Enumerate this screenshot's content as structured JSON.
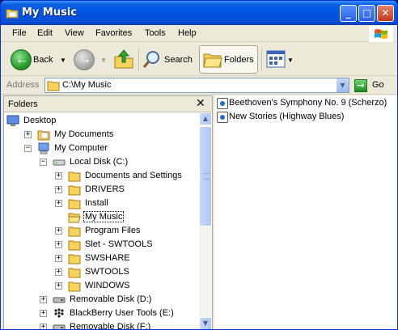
{
  "window": {
    "title": "My Music"
  },
  "menu": [
    "File",
    "Edit",
    "View",
    "Favorites",
    "Tools",
    "Help"
  ],
  "toolbar": {
    "back_label": "Back",
    "search_label": "Search",
    "folders_label": "Folders"
  },
  "address": {
    "label": "Address",
    "value": "C:\\My Music",
    "go_label": "Go"
  },
  "folders_pane": {
    "title": "Folders",
    "tree": [
      {
        "label": "Desktop",
        "icon": "desktop-icon",
        "level": 0,
        "expander": ""
      },
      {
        "label": "My Documents",
        "icon": "my-documents-icon",
        "level": 1,
        "expander": "+"
      },
      {
        "label": "My Computer",
        "icon": "my-computer-icon",
        "level": 1,
        "expander": "-"
      },
      {
        "label": "Local Disk (C:)",
        "icon": "drive-icon",
        "level": 2,
        "expander": "-"
      },
      {
        "label": "Documents and Settings",
        "icon": "folder-icon",
        "level": 3,
        "expander": "+"
      },
      {
        "label": "DRIVERS",
        "icon": "folder-icon",
        "level": 3,
        "expander": "+"
      },
      {
        "label": "Install",
        "icon": "folder-icon",
        "level": 3,
        "expander": "+"
      },
      {
        "label": "My Music",
        "icon": "folder-open-icon",
        "level": 3,
        "expander": "",
        "selected": true
      },
      {
        "label": "Program Files",
        "icon": "folder-icon",
        "level": 3,
        "expander": "+"
      },
      {
        "label": "Slet - SWTOOLS",
        "icon": "folder-icon",
        "level": 3,
        "expander": "+"
      },
      {
        "label": "SWSHARE",
        "icon": "folder-icon",
        "level": 3,
        "expander": "+"
      },
      {
        "label": "SWTOOLS",
        "icon": "folder-icon",
        "level": 3,
        "expander": "+"
      },
      {
        "label": "WINDOWS",
        "icon": "folder-icon",
        "level": 3,
        "expander": "+"
      },
      {
        "label": "Removable Disk (D:)",
        "icon": "removable-disk-icon",
        "level": 2,
        "expander": "+"
      },
      {
        "label": "BlackBerry User Tools (E:)",
        "icon": "blackberry-icon",
        "level": 2,
        "expander": "+"
      },
      {
        "label": "Removable Disk (F:)",
        "icon": "removable-disk-icon",
        "level": 2,
        "expander": "+"
      }
    ]
  },
  "files": [
    {
      "name": "Beethoven's Symphony No. 9 (Scherzo)",
      "icon": "wma-audio-icon"
    },
    {
      "name": "New Stories (Highway Blues)",
      "icon": "wma-audio-icon"
    }
  ],
  "colors": {
    "titlebar": "#0054e3",
    "selection_outline": "#000000",
    "window_bg": "#ece9d8"
  }
}
